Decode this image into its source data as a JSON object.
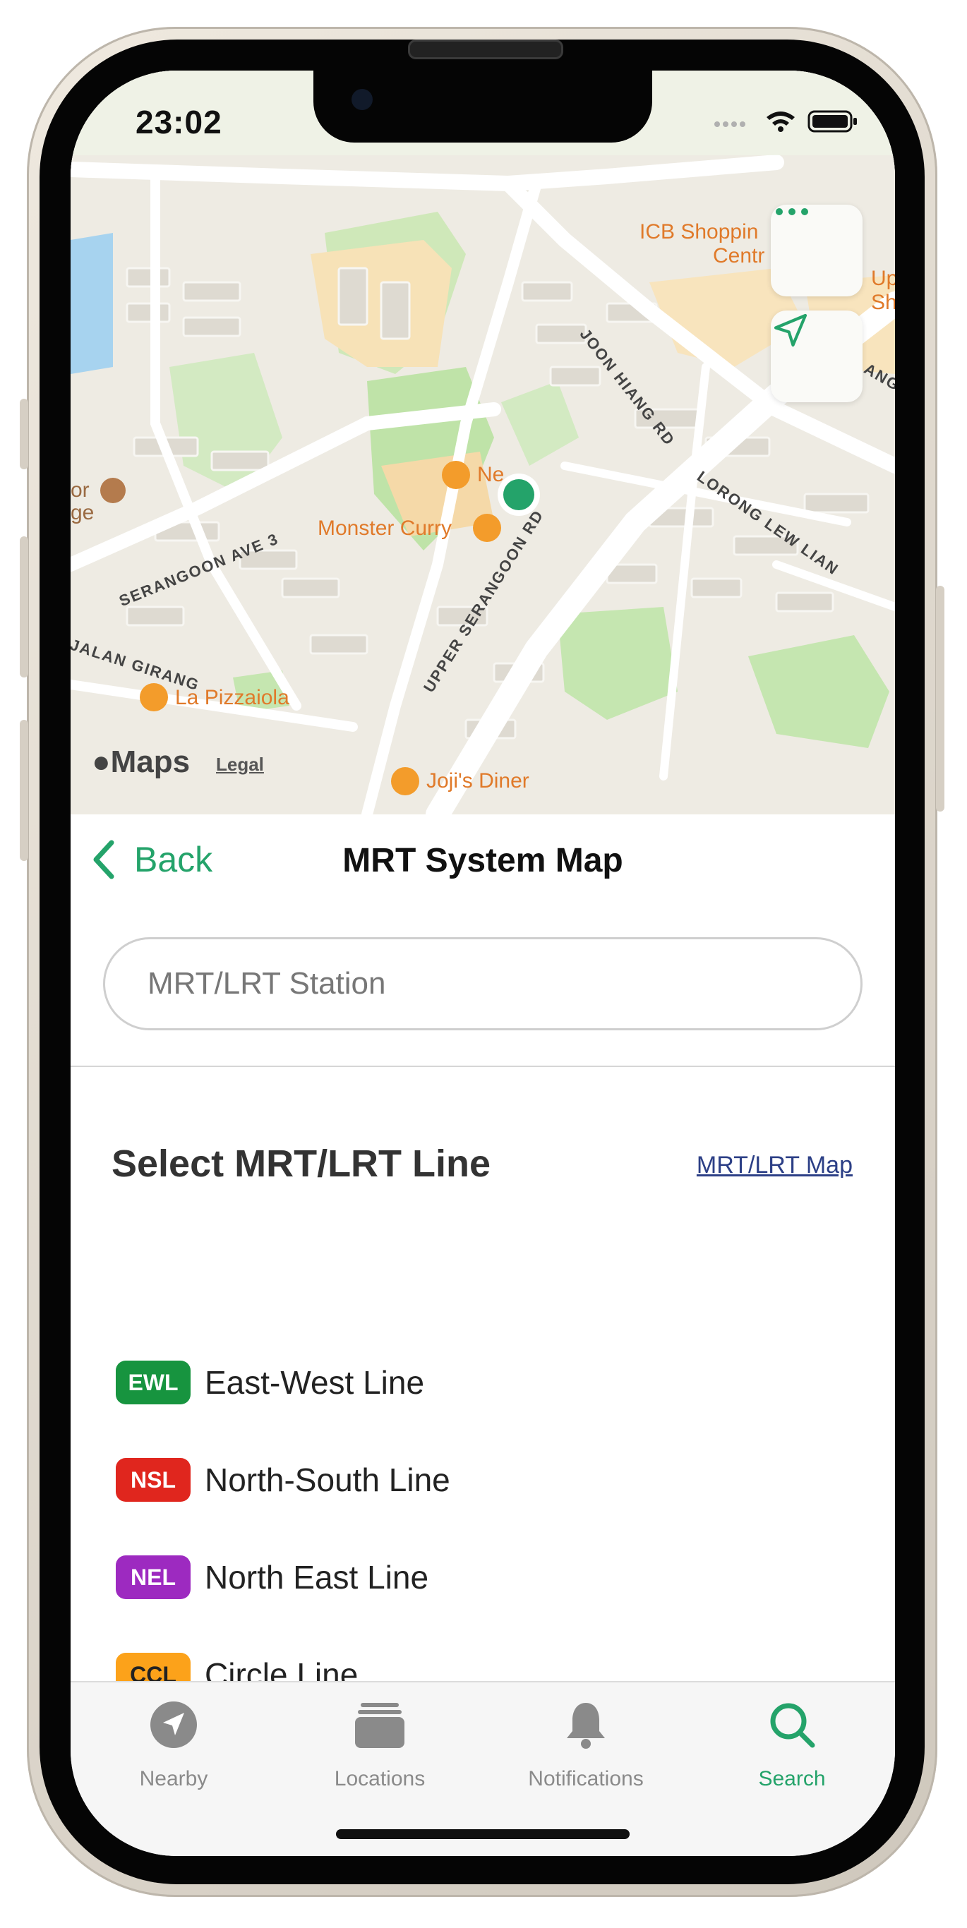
{
  "status_bar": {
    "time": "23:02"
  },
  "map": {
    "pois": [
      "ICB Shoppin",
      "Centr",
      "Up",
      "Sh",
      "Ne",
      "Monster Curry",
      "La Pizzaiola",
      "Joji's Diner",
      "or",
      "ge"
    ],
    "roads": [
      "JOON HIANG RD",
      "LORONG LEW LIAN",
      "SERANGOON AVE 3",
      "UPPER SERANGOON RD",
      "JALAN GIRANG",
      "ANG"
    ],
    "attribution": "Maps",
    "legal": "Legal",
    "more_button": "more-icon",
    "locate_button": "location-arrow-icon",
    "accent_color": "#24a36a"
  },
  "nav": {
    "back_label": "Back",
    "title": "MRT System Map"
  },
  "search": {
    "placeholder": "MRT/LRT Station",
    "value": ""
  },
  "section": {
    "title": "Select MRT/LRT Line",
    "map_link": "MRT/LRT Map"
  },
  "lines": [
    {
      "code": "EWL",
      "name": "East-West Line",
      "color": "#17943f"
    },
    {
      "code": "NSL",
      "name": "North-South Line",
      "color": "#e0261e"
    },
    {
      "code": "NEL",
      "name": "North East Line",
      "color": "#9d2ac0"
    },
    {
      "code": "CCL",
      "name": "Circle Line",
      "color": "#fca21a"
    }
  ],
  "tabs": [
    {
      "label": "Nearby",
      "icon": "navigation-icon",
      "active": false
    },
    {
      "label": "Locations",
      "icon": "folder-icon",
      "active": false
    },
    {
      "label": "Notifications",
      "icon": "bell-icon",
      "active": false
    },
    {
      "label": "Search",
      "icon": "search-icon",
      "active": true
    }
  ]
}
